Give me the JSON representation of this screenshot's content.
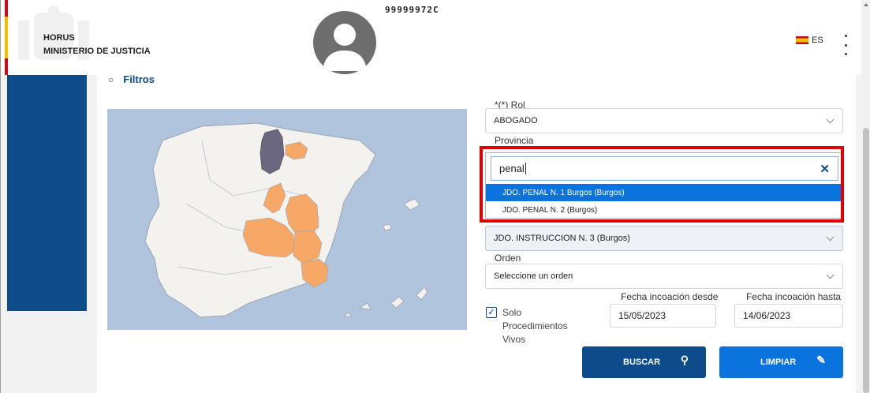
{
  "header": {
    "app_name": "HORUS",
    "ministry": "MINISTERIO DE JUSTICIA",
    "user_id": "99999972C",
    "language": "ES"
  },
  "filters": {
    "title": "Filtros",
    "rol": {
      "label": "*(*) Rol",
      "value": "ABOGADO"
    },
    "provincia": {
      "label": "Provincia",
      "search_value": "penal",
      "options": [
        "JDO. PENAL N. 1 Burgos (Burgos)",
        "JDO. PENAL N. 2 (Burgos)"
      ],
      "selected_index": 0
    },
    "organo": {
      "value": "JDO. INSTRUCCION N. 3 (Burgos)"
    },
    "orden": {
      "label": "Orden",
      "value": "Seleccione un orden"
    },
    "solo_vivos": {
      "label": "Solo Procedimientos Vivos",
      "checked": true
    },
    "fecha_desde": {
      "label": "Fecha incoación desde",
      "value": "15/05/2023"
    },
    "fecha_hasta": {
      "label": "Fecha incoación hasta",
      "value": "14/06/2023"
    },
    "buscar_label": "BUSCAR",
    "limpiar_label": "LIMPIAR"
  },
  "map": {
    "colors": {
      "sea": "#b0c4de",
      "land": "#f3f2ef",
      "selected": "#6b6781",
      "highlight": "#f8a866",
      "border": "#9aa4b0"
    }
  }
}
